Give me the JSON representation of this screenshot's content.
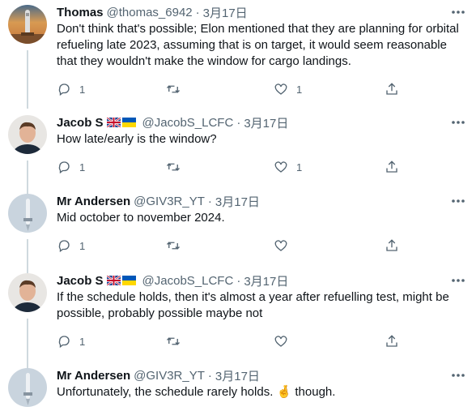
{
  "tweets": [
    {
      "name": "Thomas",
      "handle": "@thomas_6942",
      "time": "3月17日",
      "text": "Don't think that's possible; Elon mentioned that they are planning for orbital refueling late 2023, assuming that is on target, it would seem reasonable that they wouldn't make the window for cargo landings.",
      "replies": "1",
      "likes": "1"
    },
    {
      "name": "Jacob S",
      "handle": "@JacobS_LCFC",
      "time": "3月17日",
      "text": "How late/early is the window?",
      "replies": "1",
      "likes": "1"
    },
    {
      "name": "Mr Andersen",
      "handle": "@GIV3R_YT",
      "time": "3月17日",
      "text": "Mid october to november 2024.",
      "replies": "1",
      "likes": ""
    },
    {
      "name": "Jacob S",
      "handle": "@JacobS_LCFC",
      "time": "3月17日",
      "text": "If the schedule holds, then it's almost a year after refuelling test, might be possible, probably possible maybe not",
      "replies": "1",
      "likes": ""
    },
    {
      "name": "Mr Andersen",
      "handle": "@GIV3R_YT",
      "time": "3月17日",
      "text": "Unfortunately, the schedule rarely holds. 🤞 though.",
      "replies": "",
      "likes": ""
    }
  ],
  "separator": "·",
  "icons": {
    "reply": "reply-icon",
    "retweet": "retweet-icon",
    "like": "heart-icon",
    "share": "share-icon",
    "more": "more-icon",
    "flags": [
      "uk-flag-icon",
      "ukraine-flag-icon"
    ]
  },
  "colors": {
    "text": "#0f1419",
    "secondary": "#536471",
    "thread_line": "#cfd9de"
  }
}
